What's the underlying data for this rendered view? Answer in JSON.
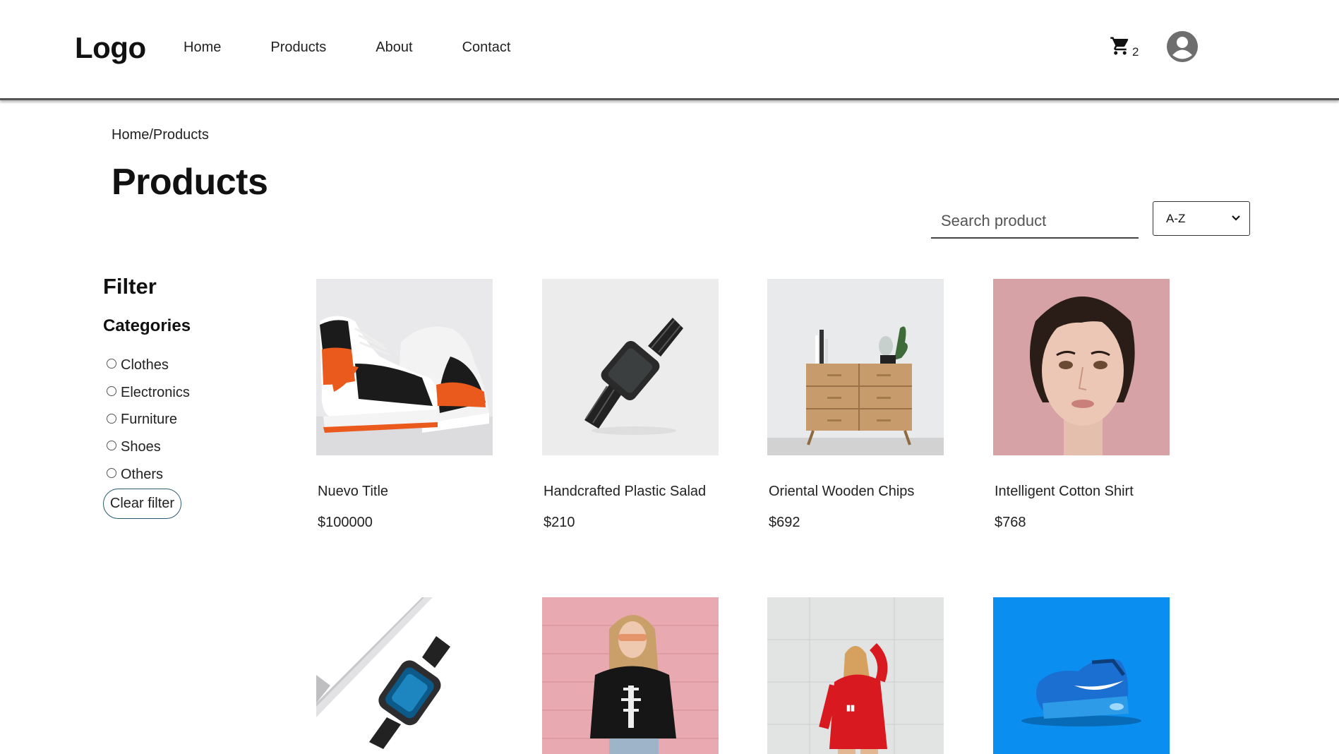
{
  "header": {
    "logo": "Logo",
    "nav": [
      "Home",
      "Products",
      "About",
      "Contact"
    ],
    "cart_count": "2"
  },
  "breadcrumb": "Home/Products",
  "page_title": "Products",
  "search": {
    "placeholder": "Search product"
  },
  "sort": {
    "selected": "A-Z"
  },
  "sidebar": {
    "filter_title": "Filter",
    "categories_title": "Categories",
    "categories": [
      "Clothes",
      "Electronics",
      "Furniture",
      "Shoes",
      "Others"
    ],
    "clear_label": "Clear filter"
  },
  "products": [
    {
      "title": "Nuevo Title",
      "price": "$100000",
      "image": "sneakers-image"
    },
    {
      "title": "Handcrafted Plastic Salad",
      "price": "$210",
      "image": "black-watch-image"
    },
    {
      "title": "Oriental Wooden Chips",
      "price": "$692",
      "image": "wooden-dresser-image"
    },
    {
      "title": "Intelligent Cotton Shirt",
      "price": "$768",
      "image": "woman-portrait-image"
    },
    {
      "title": "",
      "price": "",
      "image": "smartwatch-image"
    },
    {
      "title": "",
      "price": "",
      "image": "skeleton-tshirt-image"
    },
    {
      "title": "",
      "price": "",
      "image": "red-sweatshirt-image"
    },
    {
      "title": "",
      "price": "",
      "image": "blue-sneaker-image"
    }
  ],
  "colors": {
    "header_border": "#555555",
    "clear_border": "#2a5a6e",
    "thumb_blue": "#0a8ef0",
    "thumb_pink": "#d9a0a4"
  }
}
